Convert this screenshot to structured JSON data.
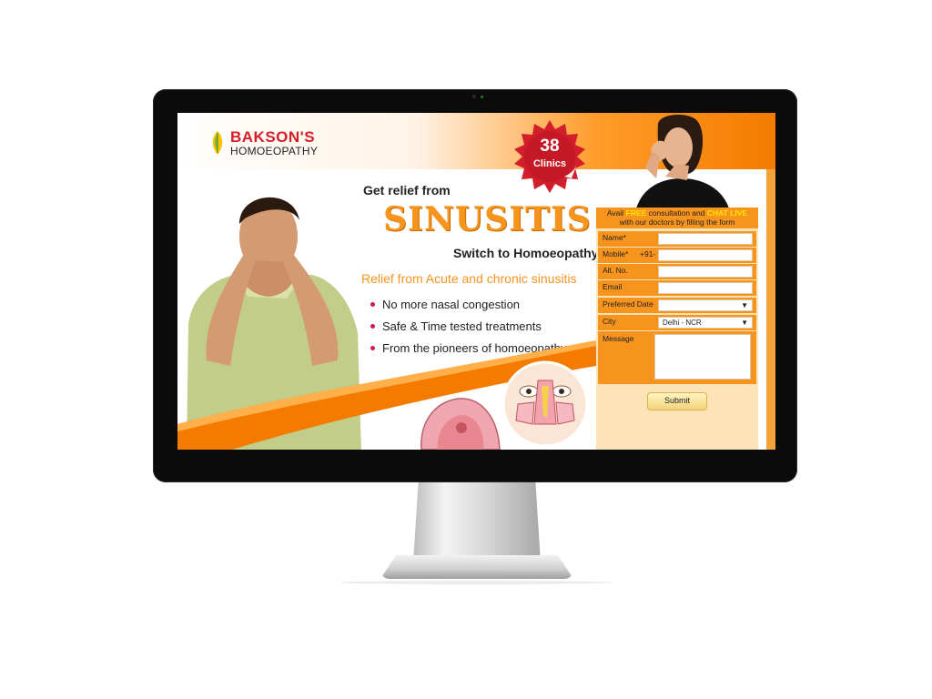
{
  "logo": {
    "brand": "BAKSON'S",
    "sub": "HOMOEOPATHY"
  },
  "badge": {
    "number": "38",
    "label": "Clinics"
  },
  "headline": {
    "intro": "Get relief from",
    "condition": "SINUSITIS",
    "cta": "Switch to Homoeopathy"
  },
  "relief": "Relief from Acute and chronic sinusitis",
  "bullets": [
    "No more nasal congestion",
    "Safe & Time tested treatments",
    "From the pioneers of homoeopathy"
  ],
  "form": {
    "head": {
      "avail": "Avail",
      "free": "FREE",
      "consult": "consultation and",
      "chat": "CHAT LIVE",
      "line2": "with our doctors by filling the form"
    },
    "fields": {
      "name": "Name*",
      "mobile": "Mobile*",
      "mobile_prefix": "+91-",
      "alt": "Alt. No.",
      "email": "Email",
      "preferred_date": "Preferred Date",
      "city": "City",
      "city_value": "Delhi - NCR",
      "message": "Message"
    },
    "submit": "Submit"
  },
  "colors": {
    "orange": "#f7941d",
    "deep_orange": "#f47b00",
    "red": "#d81e24",
    "bullet": "#d2175b"
  }
}
